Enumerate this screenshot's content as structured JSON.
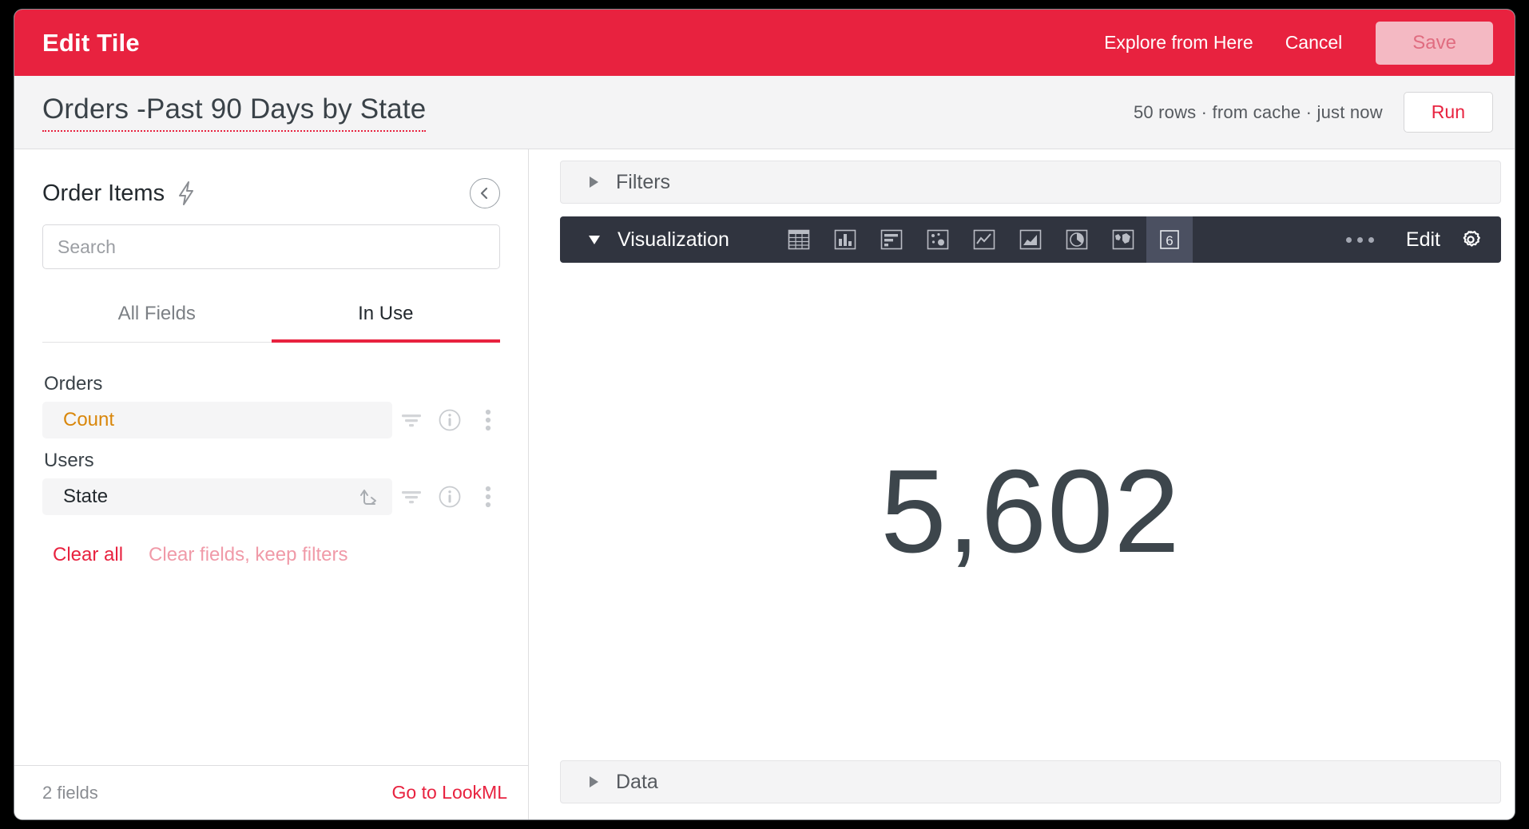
{
  "topbar": {
    "title": "Edit Tile",
    "explore_link": "Explore from Here",
    "cancel_link": "Cancel",
    "save_label": "Save",
    "accent_color": "#e8223f"
  },
  "subbar": {
    "tile_title": "Orders -Past 90 Days by State",
    "run_meta": "50 rows  ·  from cache  ·  just now",
    "run_label": "Run"
  },
  "sidebar": {
    "explore_name": "Order Items",
    "bolt_icon": "lightning-bolt-icon",
    "collapse_icon": "chevron-left-circle-icon",
    "search_placeholder": "Search",
    "search_value": "",
    "tabs": [
      {
        "label": "All Fields",
        "active": false
      },
      {
        "label": "In Use",
        "active": true
      }
    ],
    "groups": [
      {
        "label": "Orders",
        "fields": [
          {
            "name": "Count",
            "type": "measure",
            "has_pivot": false
          }
        ]
      },
      {
        "label": "Users",
        "fields": [
          {
            "name": "State",
            "type": "dimension",
            "has_pivot": true
          }
        ]
      }
    ],
    "row_icons": [
      "filter-icon",
      "info-icon",
      "kebab-menu-icon"
    ],
    "clear_all": "Clear all",
    "clear_keep_filters": "Clear fields, keep filters",
    "field_count": "2 fields",
    "lookml_link": "Go to LookML"
  },
  "main": {
    "filters_label": "Filters",
    "filters_expanded": false,
    "visualization_label": "Visualization",
    "visualization_expanded": true,
    "viz_types": [
      {
        "name": "table-chart-icon",
        "selected": false
      },
      {
        "name": "column-chart-icon",
        "selected": false
      },
      {
        "name": "bar-chart-icon",
        "selected": false
      },
      {
        "name": "scatter-chart-icon",
        "selected": false
      },
      {
        "name": "line-chart-icon",
        "selected": false
      },
      {
        "name": "area-chart-icon",
        "selected": false
      },
      {
        "name": "pie-chart-icon",
        "selected": false
      },
      {
        "name": "map-chart-icon",
        "selected": false
      },
      {
        "name": "single-value-chart-icon",
        "selected": true
      }
    ],
    "single_value_icon_label": "6",
    "more_icon": "ellipsis-icon",
    "edit_label": "Edit",
    "gear_icon": "gear-icon",
    "single_value": "5,602",
    "data_label": "Data",
    "data_expanded": false
  },
  "chart_data": {
    "type": "single_value",
    "title": "Orders -Past 90 Days by State",
    "value": 5602,
    "display_value": "5,602",
    "measure": "Orders Count",
    "dimension": "Users State",
    "row_count": 50
  }
}
